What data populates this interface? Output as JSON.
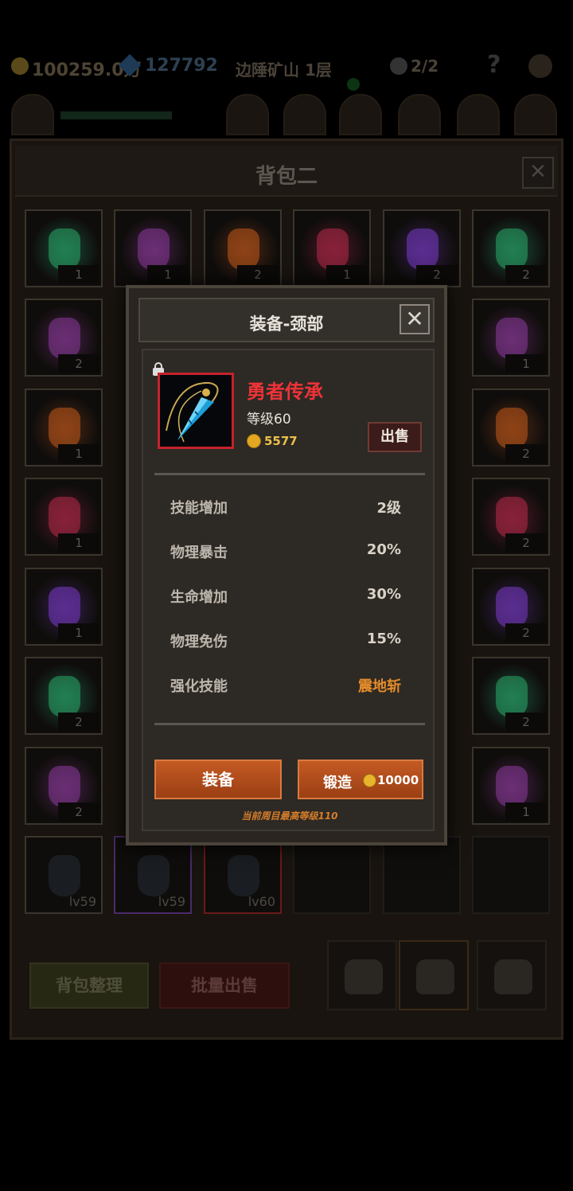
{
  "hud": {
    "gold": "100259.0万",
    "gems": "127792",
    "location": "边陲矿山 1层",
    "kills": "2/2",
    "help_label": "?"
  },
  "bag": {
    "title": "背包二",
    "close_label": "✕",
    "sort_label": "背包整理",
    "bulk_sell_label": "批量出售",
    "slots": [
      [
        "1",
        "1",
        "2",
        "1",
        "2",
        "2"
      ],
      [
        "2",
        "",
        "",
        "",
        "",
        "1"
      ],
      [
        "1",
        "",
        "",
        "",
        "",
        "2"
      ],
      [
        "1",
        "",
        "",
        "",
        "",
        "2"
      ],
      [
        "1",
        "",
        "",
        "",
        "",
        "2"
      ],
      [
        "2",
        "",
        "",
        "",
        "",
        "2"
      ],
      [
        "2",
        "",
        "",
        "",
        "",
        "1"
      ]
    ],
    "equip_levels": [
      "lv59",
      "lv59",
      "lv60"
    ]
  },
  "popup": {
    "title": "装备-颈部",
    "close_label": "✕",
    "item": {
      "name": "勇者传承",
      "level": "等级60",
      "price": "5577",
      "name_color": "#ee3338"
    },
    "sell_label": "出售",
    "stats": [
      {
        "key": "技能增加",
        "value": "2级"
      },
      {
        "key": "物理暴击",
        "value": "20%"
      },
      {
        "key": "生命增加",
        "value": "30%"
      },
      {
        "key": "物理免伤",
        "value": "15%"
      },
      {
        "key": "强化技能",
        "value": "震地斩"
      }
    ],
    "equip_label": "装备",
    "forge_label": "锻造",
    "forge_cost": "10000",
    "note": "当前周目最高等级110"
  }
}
